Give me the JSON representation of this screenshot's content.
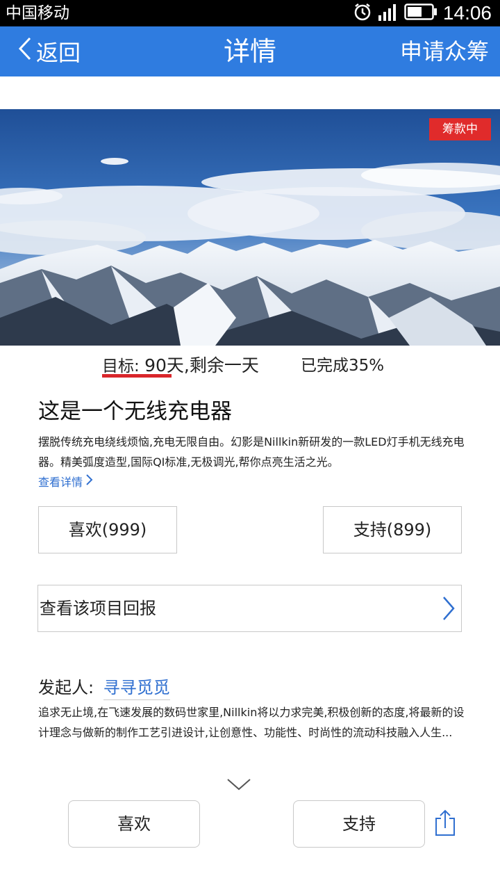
{
  "statusbar": {
    "carrier": "中国移动",
    "time": "14:06",
    "icons": [
      "alarm-icon",
      "signal-icon",
      "battery-icon"
    ]
  },
  "nav": {
    "back_label": "返回",
    "title": "详情",
    "action_label": "申请众筹"
  },
  "hero": {
    "badge": "筹款中"
  },
  "stats": {
    "goal_label": "目标:",
    "goal_value": "90天,剩余一天",
    "done_text": "已完成35%"
  },
  "project": {
    "title": "这是一个无线充电器",
    "description": "摆脱传统充电绕线烦恼,充电无限自由。幻影是Nillkin新研发的一款LED灯手机无线充电器。精美弧度造型,国际QI标准,无极调光,帮你点亮生活之光。",
    "more_link": "查看详情"
  },
  "actions": {
    "like_label": "喜欢(999)",
    "support_label": "支持(899)"
  },
  "reward": {
    "label": "查看该项目回报"
  },
  "initiator": {
    "label": "发起人:",
    "name": "寻寻觅觅",
    "description": "追求无止境,在飞速发展的数码世家里,Nillkin将以力求完美,积极创新的态度,将最新的设计理念与做新的制作工艺引进设计,让创意性、功能性、时尚性的流动科技融入人生..."
  },
  "bottom": {
    "like_label": "喜欢",
    "support_label": "支持"
  },
  "colors": {
    "nav_blue": "#2f7ce0",
    "badge_red": "#e02b2b",
    "link_blue": "#2f6fd0"
  }
}
